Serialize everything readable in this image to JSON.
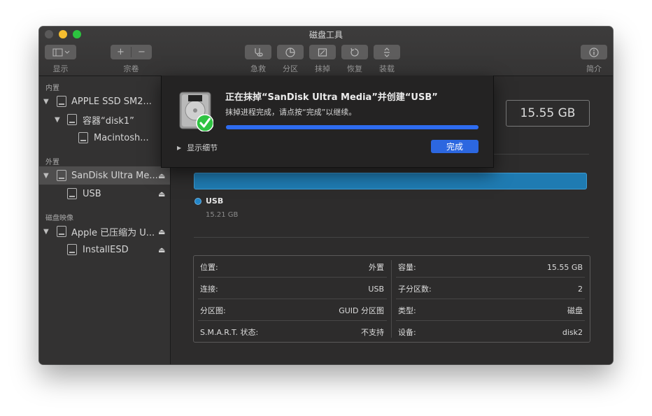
{
  "window": {
    "title": "磁盘工具"
  },
  "toolbar": {
    "view_label": "显示",
    "volume_label": "宗卷",
    "volume_add": "+",
    "volume_remove": "−",
    "firstaid_label": "急救",
    "partition_label": "分区",
    "erase_label": "抹掉",
    "restore_label": "恢复",
    "mount_label": "装载",
    "info_label": "简介"
  },
  "sidebar": {
    "sections": [
      "内置",
      "外置",
      "磁盘映像"
    ],
    "items": [
      {
        "label": "APPLE SSD SM2..."
      },
      {
        "label": "容器“disk1”"
      },
      {
        "label": "Macintosh..."
      },
      {
        "label": "SanDisk Ultra Me..."
      },
      {
        "label": "USB"
      },
      {
        "label": "Apple 已压缩为 U..."
      },
      {
        "label": "InstallESD"
      }
    ],
    "eject_glyph": "⏏"
  },
  "main": {
    "capacity": "15.55 GB",
    "partition": {
      "name": "USB",
      "size": "15.21 GB",
      "color": "#1f7bb2"
    },
    "info": {
      "left": [
        {
          "key": "位置:",
          "value": "外置"
        },
        {
          "key": "连接:",
          "value": "USB"
        },
        {
          "key": "分区图:",
          "value": "GUID 分区图"
        },
        {
          "key": "S.M.A.R.T. 状态:",
          "value": "不支持"
        }
      ],
      "right": [
        {
          "key": "容量:",
          "value": "15.55 GB"
        },
        {
          "key": "子分区数:",
          "value": "2"
        },
        {
          "key": "类型:",
          "value": "磁盘"
        },
        {
          "key": "设备:",
          "value": "disk2"
        }
      ]
    }
  },
  "sheet": {
    "title": "正在抹掉“SanDisk Ultra Media”并创建“USB”",
    "subtitle": "抹掉进程完成，请点按“完成”以继续。",
    "progress": 1.0,
    "details_label": "显示细节",
    "done_label": "完成",
    "accent": "#2c67e0"
  }
}
